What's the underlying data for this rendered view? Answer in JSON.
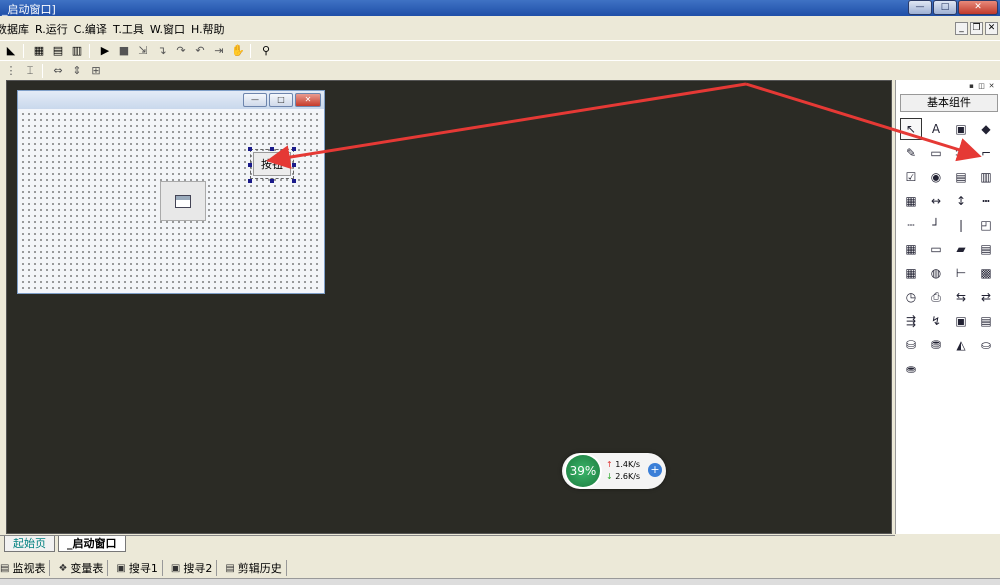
{
  "window": {
    "title": "_启动窗口]",
    "buttons": [
      "minimize",
      "maximize",
      "close"
    ]
  },
  "menu": {
    "items": [
      "数据库",
      "R.运行",
      "C.编译",
      "T.工具",
      "W.窗口",
      "H.帮助"
    ]
  },
  "toolbar1": {
    "icons": [
      "new-icon",
      "layout-icon",
      "layout2-icon",
      "layout3-icon",
      "play-icon",
      "stop-icon",
      "step-icon",
      "step-into-icon",
      "step-over-icon",
      "step-out-icon",
      "run-to-icon",
      "hand-icon",
      "find-icon"
    ]
  },
  "toolbar2": {
    "icons": [
      "align-icon",
      "align2-icon",
      "width-icon",
      "height-icon",
      "size-icon"
    ]
  },
  "form": {
    "button_label": "按钮"
  },
  "toolbox": {
    "header": "基本组件",
    "items": [
      "pointer",
      "label",
      "picture",
      "shape",
      "edit",
      "groupbox",
      "text",
      "line",
      "checkbox",
      "radio",
      "list",
      "combo",
      "grid",
      "slider",
      "vslider",
      "scroll",
      "ruler",
      "bar",
      "tab",
      "form",
      "calendar",
      "dir",
      "file",
      "table",
      "calc",
      "image",
      "list2",
      "ctl",
      "timer",
      "print",
      "net1",
      "net2",
      "net3",
      "ie",
      "panel",
      "panel2",
      "db1",
      "db2",
      "chart",
      "odbc1",
      "odbc2"
    ]
  },
  "tabs": [
    "起始页",
    "_启动窗口"
  ],
  "panel_bar": {
    "items": [
      "监视表",
      "变量表",
      "搜寻1",
      "搜寻2",
      "剪辑历史"
    ]
  },
  "net_widget": {
    "percent": "39%",
    "up": "1.4K/s",
    "down": "2.6K/s"
  },
  "colors": {
    "workspace": "#2b2b25",
    "arrow": "#e53935"
  }
}
